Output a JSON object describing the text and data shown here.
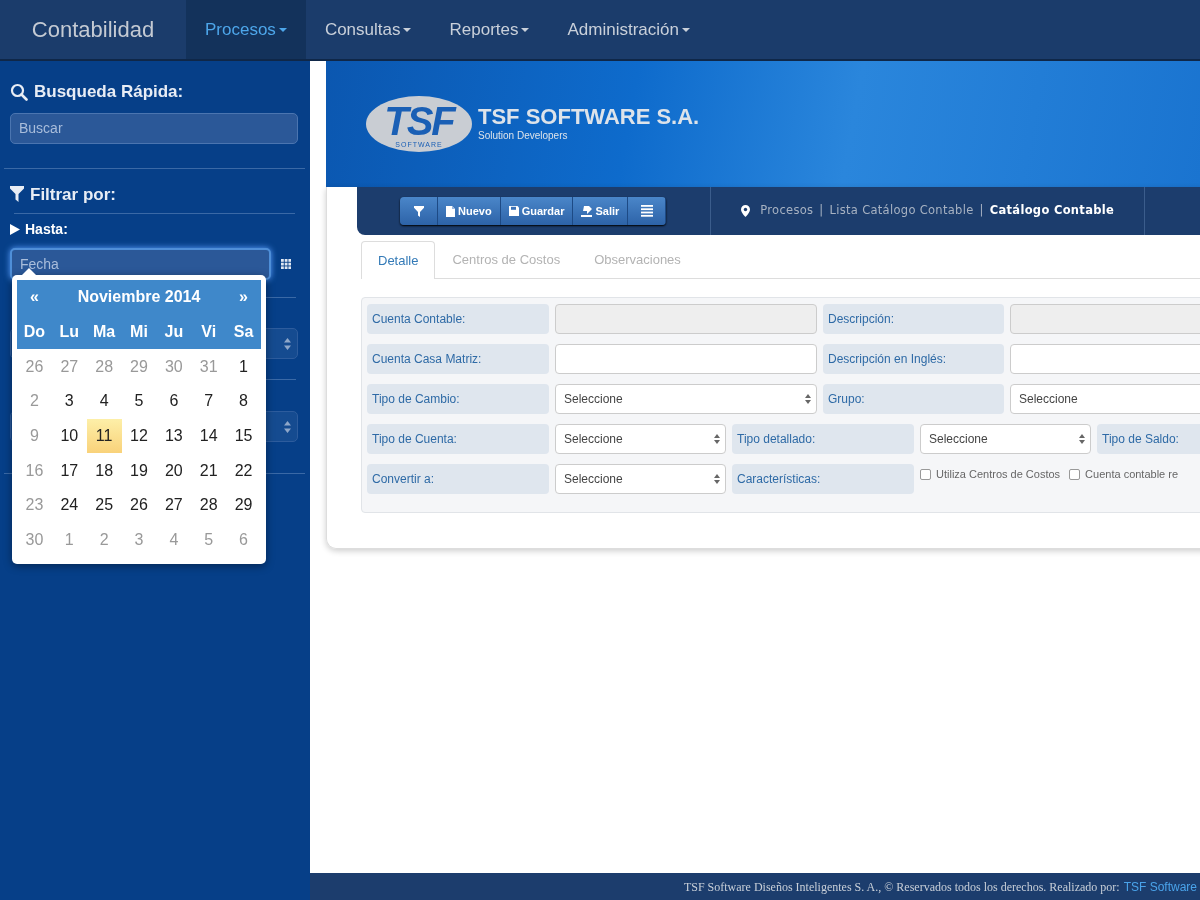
{
  "navbar": {
    "brand": "Contabilidad",
    "items": [
      {
        "label": "Procesos",
        "selected": true
      },
      {
        "label": "Consultas",
        "selected": false
      },
      {
        "label": "Reportes",
        "selected": false
      },
      {
        "label": "Administración",
        "selected": false
      }
    ]
  },
  "sidebar": {
    "search": {
      "title": "Busqueda Rápida:",
      "placeholder": "Buscar"
    },
    "filter": {
      "title": "Filtrar por:",
      "section": "Hasta:",
      "date_field": {
        "placeholder": "Fecha"
      }
    },
    "datepicker": {
      "prev": "«",
      "title": "Noviembre 2014",
      "next": "»",
      "weekdays": [
        "Do",
        "Lu",
        "Ma",
        "Mi",
        "Ju",
        "Vi",
        "Sa"
      ],
      "weeks": [
        [
          {
            "day": "26",
            "muted": true,
            "selected": false
          },
          {
            "day": "27",
            "muted": true,
            "selected": false
          },
          {
            "day": "28",
            "muted": true,
            "selected": false
          },
          {
            "day": "29",
            "muted": true,
            "selected": false
          },
          {
            "day": "30",
            "muted": true,
            "selected": false
          },
          {
            "day": "31",
            "muted": true,
            "selected": false
          },
          {
            "day": "1",
            "muted": false,
            "selected": false
          }
        ],
        [
          {
            "day": "2",
            "muted": true,
            "selected": false
          },
          {
            "day": "3",
            "muted": false,
            "selected": false
          },
          {
            "day": "4",
            "muted": false,
            "selected": false
          },
          {
            "day": "5",
            "muted": false,
            "selected": false
          },
          {
            "day": "6",
            "muted": false,
            "selected": false
          },
          {
            "day": "7",
            "muted": false,
            "selected": false
          },
          {
            "day": "8",
            "muted": false,
            "selected": false
          }
        ],
        [
          {
            "day": "9",
            "muted": true,
            "selected": false
          },
          {
            "day": "10",
            "muted": false,
            "selected": false
          },
          {
            "day": "11",
            "muted": false,
            "selected": true
          },
          {
            "day": "12",
            "muted": false,
            "selected": false
          },
          {
            "day": "13",
            "muted": false,
            "selected": false
          },
          {
            "day": "14",
            "muted": false,
            "selected": false
          },
          {
            "day": "15",
            "muted": false,
            "selected": false
          }
        ],
        [
          {
            "day": "16",
            "muted": true,
            "selected": false
          },
          {
            "day": "17",
            "muted": false,
            "selected": false
          },
          {
            "day": "18",
            "muted": false,
            "selected": false
          },
          {
            "day": "19",
            "muted": false,
            "selected": false
          },
          {
            "day": "20",
            "muted": false,
            "selected": false
          },
          {
            "day": "21",
            "muted": false,
            "selected": false
          },
          {
            "day": "22",
            "muted": false,
            "selected": false
          }
        ],
        [
          {
            "day": "23",
            "muted": true,
            "selected": false
          },
          {
            "day": "24",
            "muted": false,
            "selected": false
          },
          {
            "day": "25",
            "muted": false,
            "selected": false
          },
          {
            "day": "26",
            "muted": false,
            "selected": false
          },
          {
            "day": "27",
            "muted": false,
            "selected": false
          },
          {
            "day": "28",
            "muted": false,
            "selected": false
          },
          {
            "day": "29",
            "muted": false,
            "selected": false
          }
        ],
        [
          {
            "day": "30",
            "muted": true,
            "selected": false
          },
          {
            "day": "1",
            "muted": true,
            "selected": false
          },
          {
            "day": "2",
            "muted": true,
            "selected": false
          },
          {
            "day": "3",
            "muted": true,
            "selected": false
          },
          {
            "day": "4",
            "muted": true,
            "selected": false
          },
          {
            "day": "5",
            "muted": true,
            "selected": false
          },
          {
            "day": "6",
            "muted": true,
            "selected": false
          }
        ]
      ]
    }
  },
  "banner": {
    "logo_letters": "TSF",
    "logo_tagline": "SOFTWARE",
    "company": "TSF SOFTWARE S.A.",
    "slogan": "Solution Developers"
  },
  "toolbar": {
    "buttons": [
      {
        "kind": "filter"
      },
      {
        "kind": "new",
        "label": "Nuevo"
      },
      {
        "kind": "save",
        "label": "Guardar"
      },
      {
        "kind": "exit",
        "label": "Salir"
      },
      {
        "kind": "list"
      }
    ],
    "breadcrumb": [
      {
        "text": "Procesos",
        "current": false
      },
      {
        "text": "|",
        "current": false
      },
      {
        "text": "Lista Catálogo Contable",
        "current": false
      },
      {
        "text": "|",
        "current": false
      },
      {
        "text": "Catálogo Contable",
        "current": true
      }
    ]
  },
  "tabs": [
    {
      "label": "Detalle",
      "selected": true
    },
    {
      "label": "Centros de Costos",
      "selected": false
    },
    {
      "label": "Observaciones",
      "selected": false
    }
  ],
  "form": {
    "rows": [
      {
        "kind": "wide",
        "cells": [
          {
            "kind": "label",
            "text": "Cuenta Contable:"
          },
          {
            "kind": "input",
            "disabled": true
          },
          {
            "kind": "label",
            "text": "Descripción:"
          },
          {
            "kind": "input",
            "disabled": true
          }
        ]
      },
      {
        "kind": "wide",
        "cells": [
          {
            "kind": "label",
            "text": "Cuenta Casa Matriz:"
          },
          {
            "kind": "input",
            "disabled": false
          },
          {
            "kind": "label",
            "text": "Descripción en Inglés:"
          },
          {
            "kind": "input",
            "disabled": false
          }
        ]
      },
      {
        "kind": "wide",
        "cells": [
          {
            "kind": "label",
            "text": "Tipo de Cambio:"
          },
          {
            "kind": "select",
            "value": "Seleccione"
          },
          {
            "kind": "label",
            "text": "Grupo:"
          },
          {
            "kind": "select",
            "value": "Seleccione"
          }
        ]
      },
      {
        "kind": "narrow",
        "cells": [
          {
            "kind": "label",
            "text": "Tipo de Cuenta:"
          },
          {
            "kind": "select",
            "value": "Seleccione"
          },
          {
            "kind": "label",
            "text": "Tipo detallado:"
          },
          {
            "kind": "select",
            "value": "Seleccione"
          },
          {
            "kind": "label",
            "text": "Tipo de Saldo:"
          }
        ]
      },
      {
        "kind": "narrow",
        "cells": [
          {
            "kind": "label",
            "text": "Convertir a:"
          },
          {
            "kind": "select",
            "value": "Seleccione"
          },
          {
            "kind": "label",
            "text": "Características:"
          },
          {
            "kind": "checks",
            "items": [
              {
                "label": "Utiliza Centros de Costos",
                "checked": false
              },
              {
                "label": "Cuenta contable re",
                "checked": false
              }
            ]
          }
        ]
      }
    ]
  },
  "footer": {
    "text": "TSF Software Diseños Inteligentes S. A., © Reservados todos los derechos. Realizado por:",
    "link": "TSF Software"
  }
}
